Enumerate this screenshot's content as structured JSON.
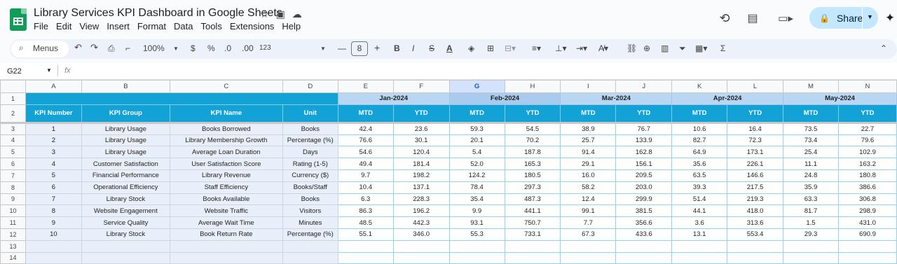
{
  "app": {
    "doc_title": "Library Services KPI Dashboard in Google Sheets",
    "menu": [
      "File",
      "Edit",
      "View",
      "Insert",
      "Format",
      "Data",
      "Tools",
      "Extensions",
      "Help"
    ],
    "share_label": "Share"
  },
  "toolbar": {
    "menus_label": "Menus",
    "zoom": "100%",
    "currency": "$",
    "percent": "%",
    "dec_decrease": ".0",
    "dec_increase": ".00",
    "number_format": "123",
    "font_size": "8"
  },
  "formula_bar": {
    "cell_ref": "G22",
    "fx": "fx",
    "value": ""
  },
  "sheet": {
    "columns": [
      "A",
      "B",
      "C",
      "D",
      "E",
      "F",
      "G",
      "H",
      "I",
      "J",
      "K",
      "L",
      "M",
      "N"
    ],
    "selected_column": "G",
    "month_headers": [
      "Jan-2024",
      "Feb-2024",
      "Mar-2024",
      "Apr-2024",
      "May-2024"
    ],
    "headers": [
      "KPI Number",
      "KPI Group",
      "KPI Name",
      "Unit"
    ],
    "sub_headers": [
      "MTD",
      "YTD"
    ],
    "rows": [
      {
        "num": "1",
        "group": "Library Usage",
        "name": "Books Borrowed",
        "unit": "Books",
        "values": [
          "42.4",
          "23.6",
          "59.3",
          "54.5",
          "38.9",
          "76.7",
          "10.6",
          "16.4",
          "73.5",
          "22.7"
        ]
      },
      {
        "num": "2",
        "group": "Library Usage",
        "name": "Library Membership Growth",
        "unit": "Percentage (%)",
        "values": [
          "76.6",
          "30.1",
          "20.1",
          "70.2",
          "25.7",
          "133.9",
          "82.7",
          "72.3",
          "73.4",
          "79.6"
        ]
      },
      {
        "num": "3",
        "group": "Library Usage",
        "name": "Average Loan Duration",
        "unit": "Days",
        "values": [
          "54.6",
          "120.4",
          "5.4",
          "187.8",
          "91.4",
          "162.8",
          "64.9",
          "173.1",
          "25.4",
          "102.9"
        ]
      },
      {
        "num": "4",
        "group": "Customer Satisfaction",
        "name": "User Satisfaction Score",
        "unit": "Rating (1-5)",
        "values": [
          "49.4",
          "181.4",
          "52.0",
          "165.3",
          "29.1",
          "156.1",
          "35.6",
          "226.1",
          "11.1",
          "163.2"
        ]
      },
      {
        "num": "5",
        "group": "Financial Performance",
        "name": "Library Revenue",
        "unit": "Currency ($)",
        "values": [
          "9.7",
          "198.2",
          "124.2",
          "180.5",
          "16.0",
          "209.5",
          "63.5",
          "146.6",
          "24.8",
          "180.8"
        ]
      },
      {
        "num": "6",
        "group": "Operational Efficiency",
        "name": "Staff Efficiency",
        "unit": "Books/Staff",
        "values": [
          "10.4",
          "137.1",
          "78.4",
          "297.3",
          "58.2",
          "203.0",
          "39.3",
          "217.5",
          "35.9",
          "386.6"
        ]
      },
      {
        "num": "7",
        "group": "Library Stock",
        "name": "Books Available",
        "unit": "Books",
        "values": [
          "6.3",
          "228.3",
          "35.4",
          "487.3",
          "12.4",
          "299.9",
          "51.4",
          "219.3",
          "63.3",
          "306.8"
        ]
      },
      {
        "num": "8",
        "group": "Website Engagement",
        "name": "Website Traffic",
        "unit": "Visitors",
        "values": [
          "86.3",
          "196.2",
          "9.9",
          "441.1",
          "99.1",
          "381.5",
          "44.1",
          "418.0",
          "81.7",
          "298.9"
        ]
      },
      {
        "num": "9",
        "group": "Service Quality",
        "name": "Average Wait Time",
        "unit": "Minutes",
        "values": [
          "48.5",
          "442.3",
          "93.1",
          "750.7",
          "7.7",
          "356.6",
          "3.6",
          "313.6",
          "1.5",
          "431.0"
        ]
      },
      {
        "num": "10",
        "group": "Library Stock",
        "name": "Book Return Rate",
        "unit": "Percentage (%)",
        "values": [
          "55.1",
          "346.0",
          "55.3",
          "733.1",
          "67.3",
          "433.6",
          "13.1",
          "553.4",
          "29.3",
          "690.9"
        ]
      }
    ],
    "row_numbers": [
      "1",
      "2",
      "3",
      "4",
      "5",
      "6",
      "7",
      "8",
      "9",
      "10",
      "11",
      "12",
      "13",
      "14"
    ]
  }
}
